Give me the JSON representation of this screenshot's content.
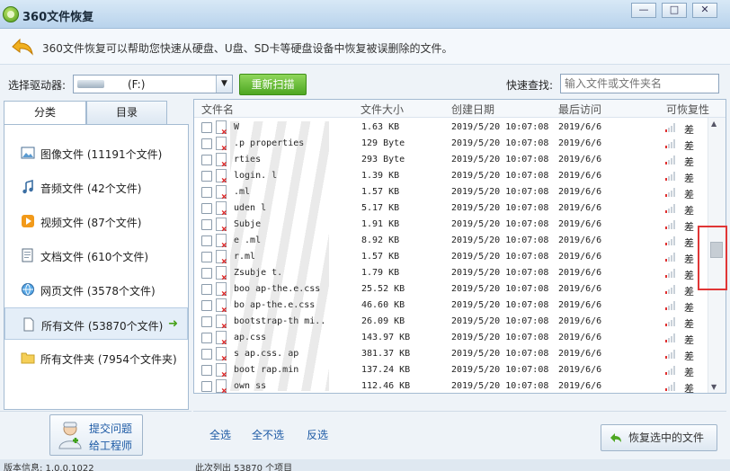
{
  "window": {
    "title": "360文件恢复",
    "minimize": "—",
    "maximize": "□",
    "close": "✕"
  },
  "info": {
    "text": "360文件恢复可以帮助您快速从硬盘、U盘、SD卡等硬盘设备中恢复被误删除的文件。"
  },
  "drive": {
    "label": "选择驱动器:",
    "selected": "(F:)",
    "scan_button": "重新扫描",
    "search_label": "快速查找:",
    "search_placeholder": "输入文件或文件夹名"
  },
  "tabs": [
    "分类",
    "目录"
  ],
  "categories": [
    {
      "label": "图像文件 (11191个文件)",
      "icon": "image-icon"
    },
    {
      "label": "音频文件 (42个文件)",
      "icon": "music-icon"
    },
    {
      "label": "视频文件 (87个文件)",
      "icon": "video-icon"
    },
    {
      "label": "文档文件 (610个文件)",
      "icon": "document-icon"
    },
    {
      "label": "网页文件 (3578个文件)",
      "icon": "webpage-icon"
    },
    {
      "label": "所有文件 (53870个文件)",
      "icon": "file-icon"
    },
    {
      "label": "所有文件夹 (7954个文件夹)",
      "icon": "folder-icon"
    }
  ],
  "help": {
    "line1": "提交问题",
    "line2": "给工程师"
  },
  "columns": [
    "文件名",
    "文件大小",
    "创建日期",
    "最后访问",
    "可恢复性"
  ],
  "rows": [
    {
      "name": "W",
      "size": "1.63 KB",
      "created": "2019/5/20 10:07:08",
      "accessed": "2019/6/6",
      "rec": "差"
    },
    {
      "name": "  .p properties",
      "size": "129 Byte",
      "created": "2019/5/20 10:07:08",
      "accessed": "2019/6/6",
      "rec": "差"
    },
    {
      "name": "       rties",
      "size": "293 Byte",
      "created": "2019/5/20 10:07:08",
      "accessed": "2019/6/6",
      "rec": "差"
    },
    {
      "name": "login. l",
      "size": "1.39 KB",
      "created": "2019/5/20 10:07:08",
      "accessed": "2019/6/6",
      "rec": "差"
    },
    {
      "name": "   .ml",
      "size": "1.57 KB",
      "created": "2019/5/20 10:07:08",
      "accessed": "2019/6/6",
      "rec": "差"
    },
    {
      "name": "  uden  l",
      "size": "5.17 KB",
      "created": "2019/5/20 10:07:08",
      "accessed": "2019/6/6",
      "rec": "差"
    },
    {
      "name": "Subje",
      "size": "1.91 KB",
      "created": "2019/5/20 10:07:08",
      "accessed": "2019/6/6",
      "rec": "差"
    },
    {
      "name": "  e  .ml",
      "size": "8.92 KB",
      "created": "2019/5/20 10:07:08",
      "accessed": "2019/6/6",
      "rec": "差"
    },
    {
      "name": "   r.ml",
      "size": "1.57 KB",
      "created": "2019/5/20 10:07:08",
      "accessed": "2019/6/6",
      "rec": "差"
    },
    {
      "name": "Zsubje t.",
      "size": "1.79 KB",
      "created": "2019/5/20 10:07:08",
      "accessed": "2019/6/6",
      "rec": "差"
    },
    {
      "name": "boo  ap-the.e.css",
      "size": "25.52 KB",
      "created": "2019/5/20 10:07:08",
      "accessed": "2019/6/6",
      "rec": "差"
    },
    {
      "name": "bo   ap-the.e.css",
      "size": "46.60 KB",
      "created": "2019/5/20 10:07:08",
      "accessed": "2019/6/6",
      "rec": "差"
    },
    {
      "name": "bootstrap-th   mi..",
      "size": "26.09 KB",
      "created": "2019/5/20 10:07:08",
      "accessed": "2019/6/6",
      "rec": "差"
    },
    {
      "name": "   ap.css",
      "size": "143.97 KB",
      "created": "2019/5/20 10:07:08",
      "accessed": "2019/6/6",
      "rec": "差"
    },
    {
      "name": "   s ap.css. ap",
      "size": "381.37 KB",
      "created": "2019/5/20 10:07:08",
      "accessed": "2019/6/6",
      "rec": "差"
    },
    {
      "name": "boot rap.min",
      "size": "137.24 KB",
      "created": "2019/5/20 10:07:08",
      "accessed": "2019/6/6",
      "rec": "差"
    },
    {
      "name": "    own    ss",
      "size": "112.46 KB",
      "created": "2019/5/20 10:07:08",
      "accessed": "2019/6/6",
      "rec": "差"
    }
  ],
  "actions": {
    "select_all": "全选",
    "select_none": "全不选",
    "invert": "反选",
    "recover": "恢复选中的文件"
  },
  "status": {
    "version": "版本信息: 1.0.0.1022",
    "count": "此次列出 53870 个项目"
  },
  "colors": {
    "accent_green": "#4ea722",
    "link_blue": "#1d5aa5",
    "highlight_red": "#e03636"
  }
}
